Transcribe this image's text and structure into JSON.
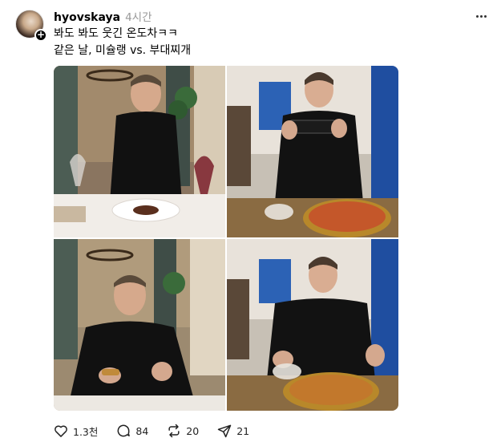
{
  "post": {
    "username": "hyovskaya",
    "time": "4시간",
    "caption_lines": [
      "봐도 봐도 웃긴 온도차ㅋㅋ",
      "같은 날, 미슐랭 vs. 부대찌개"
    ]
  },
  "photos": [
    {
      "scene": "fine-dining-restaurant"
    },
    {
      "scene": "taking-photo-of-stew"
    },
    {
      "scene": "eating-appetizer"
    },
    {
      "scene": "budae-jjigae-pot"
    }
  ],
  "actions": {
    "like_count": "1.3천",
    "comment_count": "84",
    "repost_count": "20",
    "share_count": "21"
  },
  "icons": [
    "plus-icon",
    "more-icon",
    "heart-icon",
    "comment-icon",
    "repost-icon",
    "share-icon"
  ]
}
